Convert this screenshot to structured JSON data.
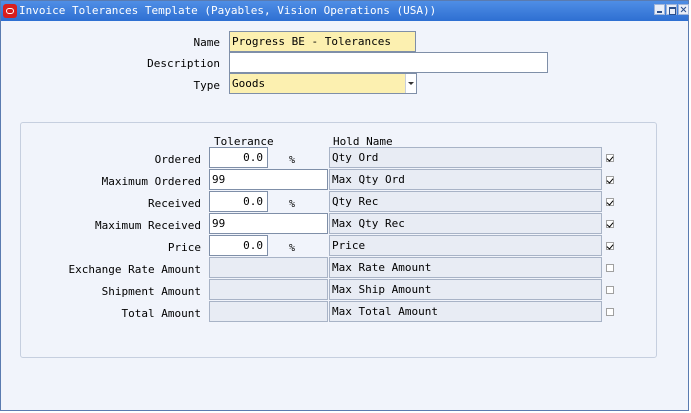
{
  "window": {
    "title": "Invoice Tolerances Template (Payables, Vision Operations (USA))"
  },
  "header": {
    "name_label": "Name",
    "name_value": "Progress BE - Tolerances",
    "description_label": "Description",
    "description_value": "",
    "type_label": "Type",
    "type_value": "Goods"
  },
  "tolerances": {
    "col_tolerance": "Tolerance",
    "col_hold_name": "Hold Name",
    "rows": [
      {
        "label": "Ordered",
        "tolerance": "0.0",
        "percent": "%",
        "hold_name": "Qty Ord",
        "checked": true
      },
      {
        "label": "Maximum Ordered",
        "tolerance": "99",
        "percent": "",
        "hold_name": "Max Qty Ord",
        "checked": true
      },
      {
        "label": "Received",
        "tolerance": "0.0",
        "percent": "%",
        "hold_name": "Qty Rec",
        "checked": true
      },
      {
        "label": "Maximum Received",
        "tolerance": "99",
        "percent": "",
        "hold_name": "Max Qty Rec",
        "checked": true
      },
      {
        "label": "Price",
        "tolerance": "0.0",
        "percent": "%",
        "hold_name": "Price",
        "checked": true
      },
      {
        "label": "Exchange Rate Amount",
        "tolerance": "",
        "percent": "",
        "hold_name": "Max Rate Amount",
        "checked": false
      },
      {
        "label": "Shipment Amount",
        "tolerance": "",
        "percent": "",
        "hold_name": "Max Ship Amount",
        "checked": false
      },
      {
        "label": "Total Amount",
        "tolerance": "",
        "percent": "",
        "hold_name": "Max Total Amount",
        "checked": false
      }
    ]
  }
}
